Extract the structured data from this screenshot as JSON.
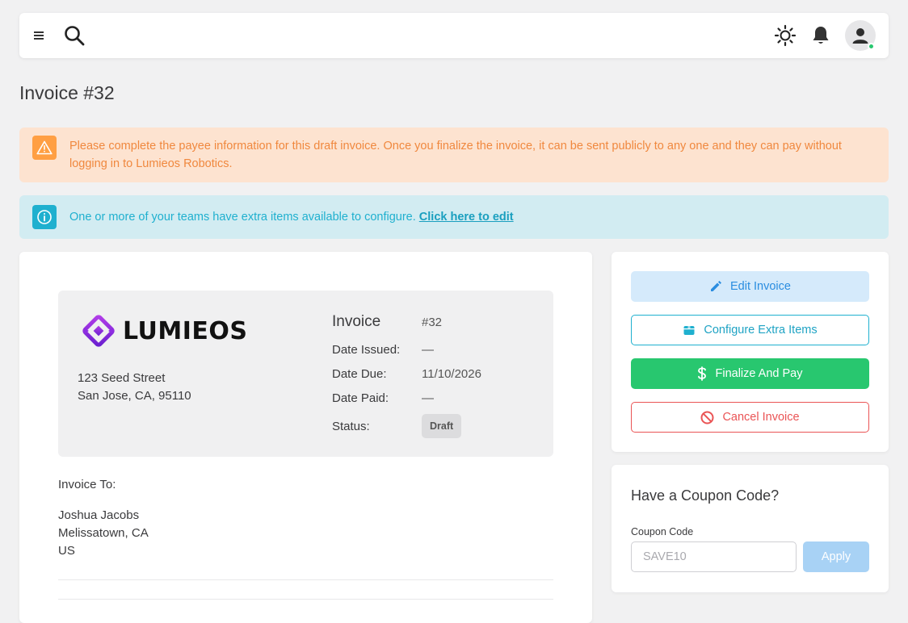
{
  "navbar": {
    "menu_icon": "menu-icon",
    "search_icon": "search-icon",
    "theme_icon": "sun-icon",
    "notification_icon": "bell-icon",
    "avatar_icon": "user-icon",
    "online_color": "#28c76f"
  },
  "page": {
    "title": "Invoice #32"
  },
  "alerts": {
    "warning": {
      "icon": "warning-triangle-icon",
      "text": "Please complete the payee information for this draft invoice. Once you finalize the invoice, it can be sent publicly to any one and they can pay without logging in to Lumieos Robotics."
    },
    "info": {
      "icon": "info-circle-icon",
      "text": "One or more of your teams have extra items available to configure.",
      "link": "Click here to edit"
    }
  },
  "invoice": {
    "company": {
      "logo_text": "LUMIEOS",
      "address_line1": "123 Seed Street",
      "address_line2": "San Jose, CA, 95110"
    },
    "meta": {
      "invoice_label": "Invoice",
      "invoice_number": "#32",
      "date_issued_label": "Date Issued:",
      "date_issued": "—",
      "date_due_label": "Date Due:",
      "date_due": "11/10/2026",
      "date_paid_label": "Date Paid:",
      "date_paid": "—",
      "status_label": "Status:",
      "status": "Draft"
    },
    "invoice_to_label": "Invoice To:",
    "client": {
      "name": "Joshua Jacobs",
      "city": "Melissatown, CA",
      "country": "US"
    }
  },
  "actions": {
    "edit": "Edit Invoice",
    "configure": "Configure Extra Items",
    "pay": "Finalize And Pay",
    "cancel": "Cancel Invoice"
  },
  "coupon": {
    "title": "Have a Coupon Code?",
    "label": "Coupon Code",
    "placeholder": "SAVE10",
    "value": "",
    "apply": "Apply"
  },
  "colors": {
    "warning": "#ff9f43",
    "info": "#1fb0cf",
    "success": "#28c76f",
    "danger": "#ea5455",
    "primary": "#2a8de0",
    "brand": "#8e2de2"
  }
}
